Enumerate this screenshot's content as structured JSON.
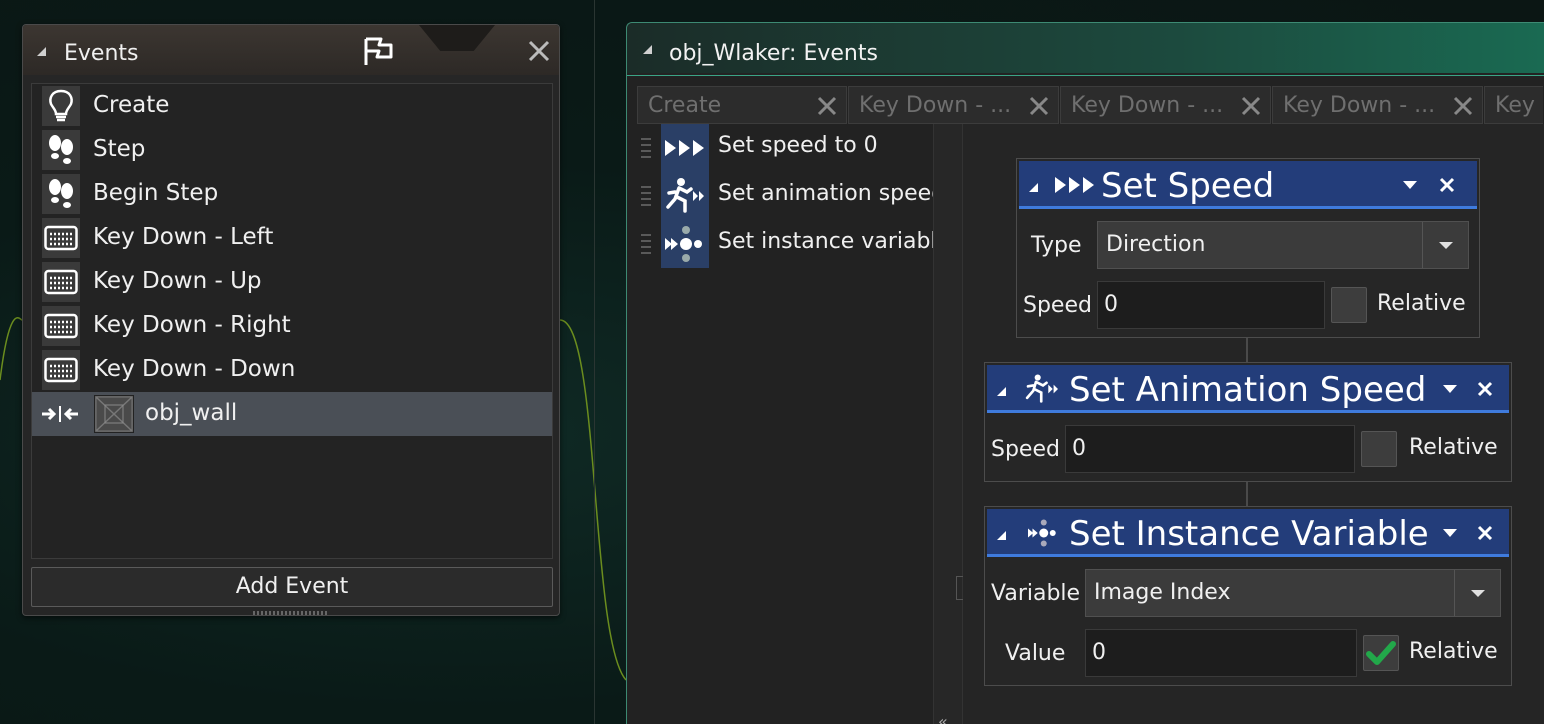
{
  "events_panel": {
    "title": "Events",
    "add_event_label": "Add Event",
    "events": [
      {
        "label": "Create",
        "icon": "lightbulb-icon"
      },
      {
        "label": "Step",
        "icon": "footprints-icon"
      },
      {
        "label": "Begin Step",
        "icon": "footprints-icon"
      },
      {
        "label": "Key Down - Left",
        "icon": "keyboard-icon"
      },
      {
        "label": "Key Down - Up",
        "icon": "keyboard-icon"
      },
      {
        "label": "Key Down - Right",
        "icon": "keyboard-icon"
      },
      {
        "label": "Key Down - Down",
        "icon": "keyboard-icon"
      },
      {
        "label": "obj_wall",
        "icon": "collision-icon",
        "selected": true
      }
    ]
  },
  "object_events": {
    "title": "obj_Wlaker: Events",
    "tabs": [
      {
        "label": "Create"
      },
      {
        "label": "Key Down - ..."
      },
      {
        "label": "Key Down - ..."
      },
      {
        "label": "Key Down - ..."
      },
      {
        "label": "Key D"
      }
    ],
    "actions": [
      {
        "label": "Set speed to 0",
        "icon": "speed-arrows-icon"
      },
      {
        "label": "Set animation speed",
        "icon": "running-man-icon"
      },
      {
        "label": "Set instance variable",
        "icon": "instance-variable-icon"
      }
    ],
    "collapse_glyph": "«"
  },
  "cards": {
    "set_speed": {
      "title": "Set Speed",
      "type_label": "Type",
      "type_value": "Direction",
      "speed_label": "Speed",
      "speed_value": "0",
      "relative_label": "Relative",
      "relative_checked": false
    },
    "set_anim_speed": {
      "title": "Set Animation Speed",
      "speed_label": "Speed",
      "speed_value": "0",
      "relative_label": "Relative",
      "relative_checked": false
    },
    "set_instance_var": {
      "title": "Set Instance Variable",
      "variable_label": "Variable",
      "variable_value": "Image Index",
      "value_label": "Value",
      "value_value": "0",
      "relative_label": "Relative",
      "relative_checked": true
    }
  },
  "colors": {
    "card_header": "#233d7a",
    "card_header_accent": "#3f7bdd",
    "window_accent": "#3aa586",
    "checkmark": "#22a84a",
    "selected_row": "#4a4f56"
  }
}
